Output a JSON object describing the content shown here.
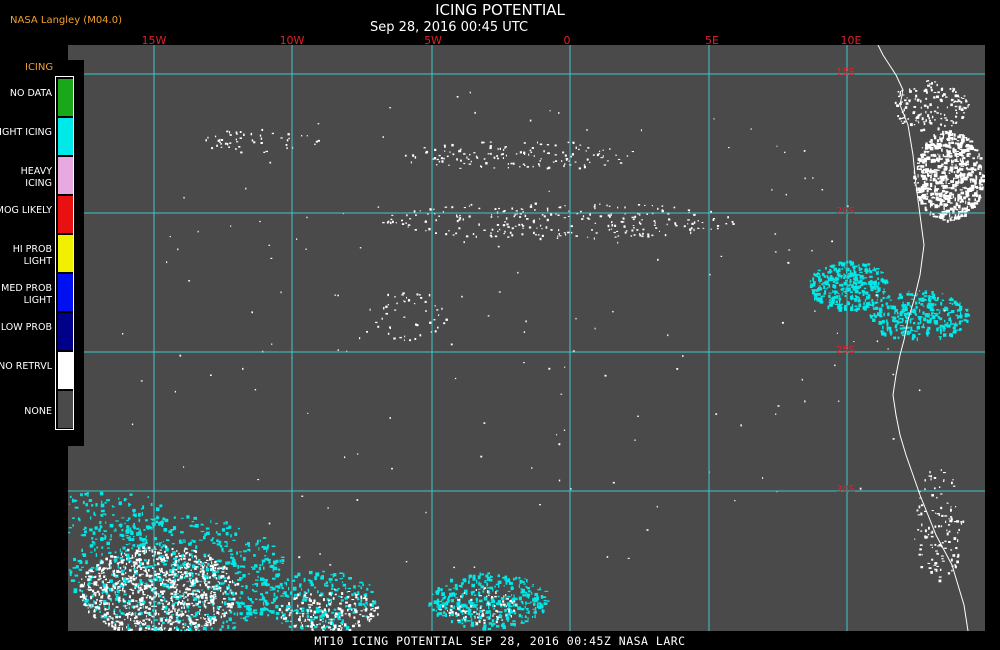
{
  "header": {
    "source": "NASA Langley (M04.0)",
    "title": "ICING POTENTIAL",
    "datetime": "Sep 28, 2016 00:45 UTC"
  },
  "longitude_labels": [
    "15W",
    "10W",
    "5W",
    "0",
    "5E",
    "10E"
  ],
  "latitude_labels": [
    "15S",
    "20S",
    "25S",
    "30S"
  ],
  "legend": {
    "title": "ICING",
    "items": [
      {
        "label": "NO DATA",
        "color": "#1aa81a"
      },
      {
        "label": "NIGHT ICING",
        "color": "#00e8e8"
      },
      {
        "label": "HEAVY ICING",
        "color": "#e8a8e0"
      },
      {
        "label": "MOG LIKELY",
        "color": "#e81010"
      },
      {
        "label": "HI PROB LIGHT",
        "color": "#f0f000"
      },
      {
        "label": "MED PROB LIGHT",
        "color": "#0010f0"
      },
      {
        "label": "LOW PROB",
        "color": "#00008a"
      },
      {
        "label": "NO RETRVL",
        "color": "#ffffff"
      },
      {
        "label": "NONE",
        "color": "#4a4a4a"
      }
    ]
  },
  "footer": "MT10  ICING POTENTIAL   SEP 28, 2016 00:45Z   NASA LARC",
  "colors": {
    "background": "#4a4a4a",
    "grid": "#3cc8c8",
    "night_icing": "#00e8e8",
    "no_retrieval": "#ffffff",
    "coastline": "#ffffff"
  }
}
